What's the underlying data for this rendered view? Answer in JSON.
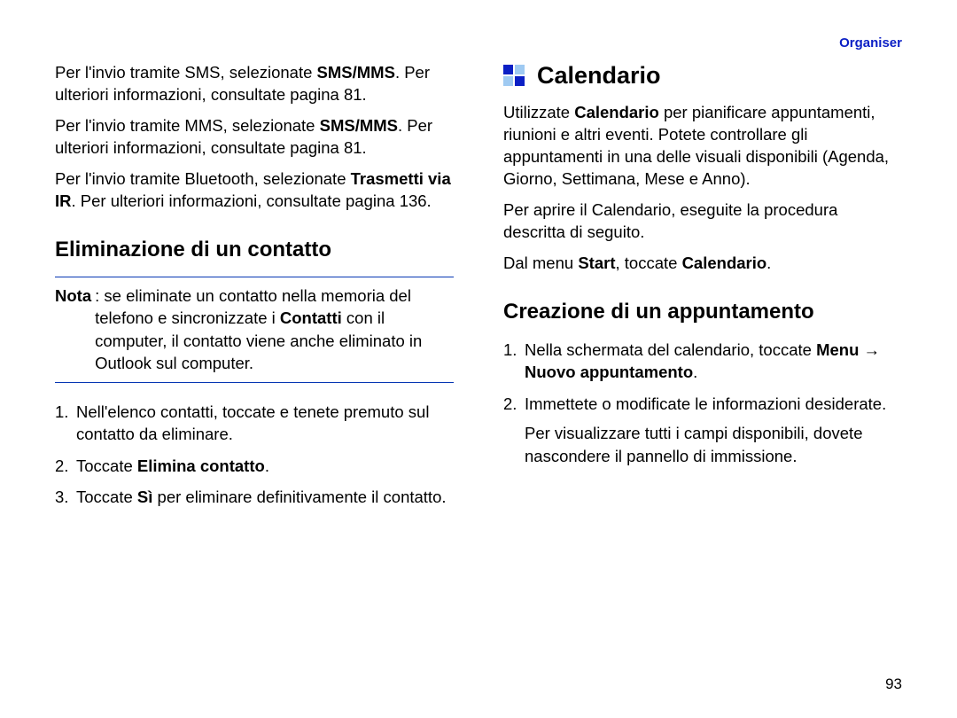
{
  "header": {
    "label": "Organiser"
  },
  "left": {
    "p1_pre": "Per l'invio tramite SMS, selezionate ",
    "p1_bold": "SMS/MMS",
    "p1_post": ". Per ulteriori informazioni, consultate pagina 81.",
    "p2_pre": "Per l'invio tramite MMS, selezionate ",
    "p2_bold": "SMS/MMS",
    "p2_post": ". Per ulteriori informazioni, consultate pagina 81.",
    "p3_pre": "Per l'invio tramite Bluetooth, selezionate ",
    "p3_bold": "Trasmetti via IR",
    "p3_post": ". Per ulteriori informazioni, consultate pagina 136.",
    "heading": "Eliminazione di un contatto",
    "note_label": "Nota",
    "note_pre": ": se eliminate un contatto nella memoria del telefono e sincronizzate i ",
    "note_bold": "Contatti",
    "note_post": " con il computer, il contatto viene anche eliminato in Outlook sul computer.",
    "li1_num": "1.",
    "li1": "Nell'elenco contatti, toccate e tenete premuto sul contatto da eliminare.",
    "li2_num": "2.",
    "li2_pre": "Toccate ",
    "li2_bold": "Elimina contatto",
    "li2_post": ".",
    "li3_num": "3.",
    "li3_pre": "Toccate ",
    "li3_bold": "Sì",
    "li3_post": " per eliminare definitivamente il contatto."
  },
  "right": {
    "title": "Calendario",
    "p1_pre": "Utilizzate ",
    "p1_bold": "Calendario",
    "p1_post": " per pianificare appuntamenti, riunioni e altri eventi. Potete controllare gli appuntamenti in una delle visuali disponibili (Agenda, Giorno, Settimana, Mese e Anno).",
    "p2": "Per aprire il Calendario, eseguite la procedura descritta di seguito.",
    "p3_pre": "Dal menu ",
    "p3_bold1": "Start",
    "p3_mid": ", toccate ",
    "p3_bold2": "Calendario",
    "p3_post": ".",
    "heading": "Creazione di un appuntamento",
    "li1_num": "1.",
    "li1_pre": "Nella schermata del calendario, toccate ",
    "li1_bold": "Menu → Nuovo appuntamento",
    "li1_post": ".",
    "li2_num": "2.",
    "li2": "Immettete o modificate le informazioni desiderate.",
    "li2_extra": "Per visualizzare tutti i campi disponibili, dovete nascondere il pannello di immissione."
  },
  "page_number": "93"
}
